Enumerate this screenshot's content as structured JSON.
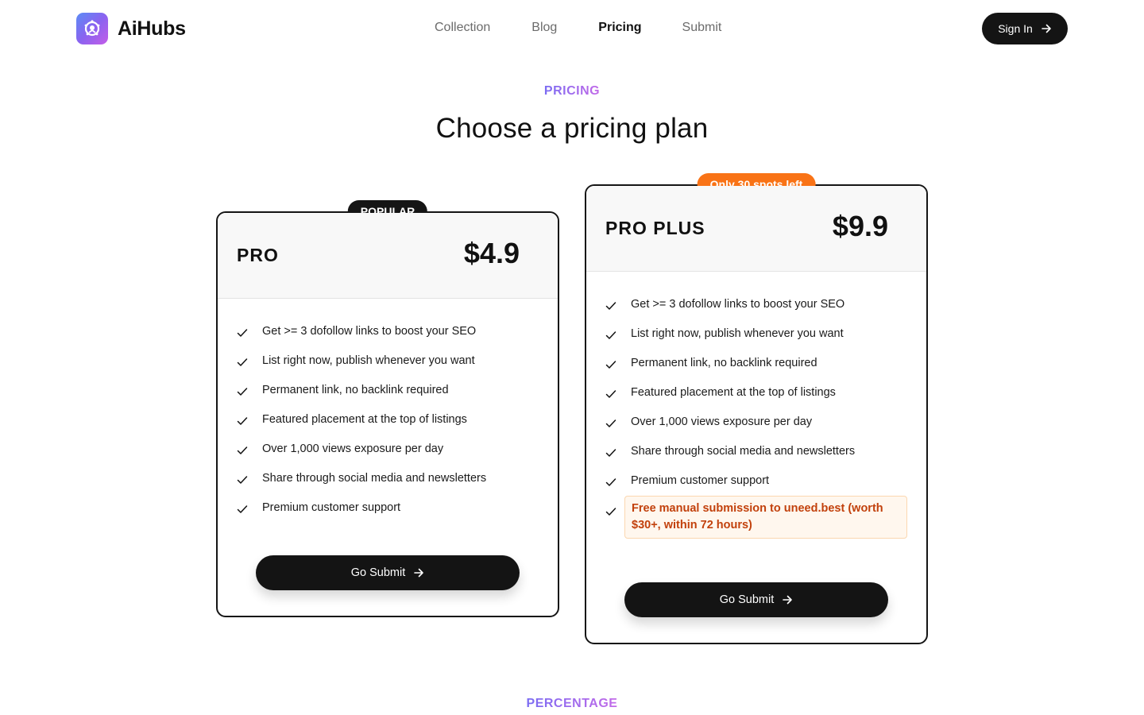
{
  "brand": {
    "name": "AiHubs",
    "logo_icon": "ai-robot-icon"
  },
  "nav": {
    "items": [
      {
        "label": "Collection",
        "active": false
      },
      {
        "label": "Blog",
        "active": false
      },
      {
        "label": "Pricing",
        "active": true
      },
      {
        "label": "Submit",
        "active": false
      }
    ]
  },
  "header": {
    "signin_label": "Sign In",
    "signin_icon": "arrow-right-icon"
  },
  "hero": {
    "eyebrow": "PRICING",
    "title": "Choose a pricing plan"
  },
  "plans": [
    {
      "badge": "POPULAR",
      "name": "PRO",
      "price": "$4.9",
      "features": [
        "Get >= 3 dofollow links to boost your SEO",
        "List right now, publish whenever you want",
        "Permanent link, no backlink required",
        "Featured placement at the top of listings",
        "Over 1,000 views exposure per day",
        "Share through social media and newsletters",
        "Premium customer support"
      ],
      "cta": "Go Submit"
    },
    {
      "badge": "Only 30 spots left",
      "name": "PRO PLUS",
      "price": "$9.9",
      "features": [
        "Get >= 3 dofollow links to boost your SEO",
        "List right now, publish whenever you want",
        "Permanent link, no backlink required",
        "Featured placement at the top of listings",
        "Over 1,000 views exposure per day",
        "Share through social media and newsletters",
        "Premium customer support"
      ],
      "highlight_feature": "Free manual submission to uneed.best (worth $30+, within 72 hours)",
      "cta": "Go Submit"
    }
  ],
  "next_section": {
    "eyebrow": "PERCENTAGE"
  },
  "colors": {
    "accent_gradient_start": "#7b6cf2",
    "accent_gradient_end": "#c26ae8",
    "badge_orange": "#f97316",
    "highlight_text": "#c2410c",
    "highlight_bg": "#fff7ee",
    "button_dark": "#141414"
  }
}
